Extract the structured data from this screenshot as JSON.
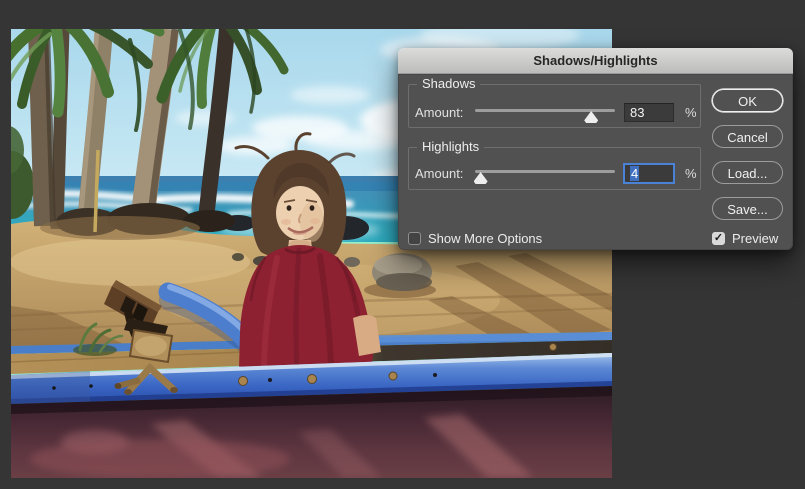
{
  "app": {
    "canvas_background": "#353535"
  },
  "dialog": {
    "title": "Shadows/Highlights",
    "sections": [
      {
        "legend": "Shadows",
        "amount_label": "Amount:",
        "value": "83",
        "unit": "%",
        "slider_percent": 83,
        "focused": false
      },
      {
        "legend": "Highlights",
        "amount_label": "Amount:",
        "value": "4",
        "unit": "%",
        "slider_percent": 4,
        "focused": true
      }
    ],
    "buttons": [
      {
        "label": "OK",
        "default": true
      },
      {
        "label": "Cancel"
      },
      {
        "label": "Load..."
      },
      {
        "label": "Save..."
      }
    ],
    "checkboxes": [
      {
        "label": "Show More Options",
        "checked": false
      },
      {
        "label": "Preview",
        "checked": true
      }
    ],
    "colors": {
      "body": "#515151",
      "titlebar_top": "#dcdcda",
      "titlebar_bottom": "#bcbcba",
      "focus_ring": "#4a82d8",
      "text_selection": "#3f6fbe"
    }
  },
  "icons": {
    "checkmark": "✓"
  }
}
